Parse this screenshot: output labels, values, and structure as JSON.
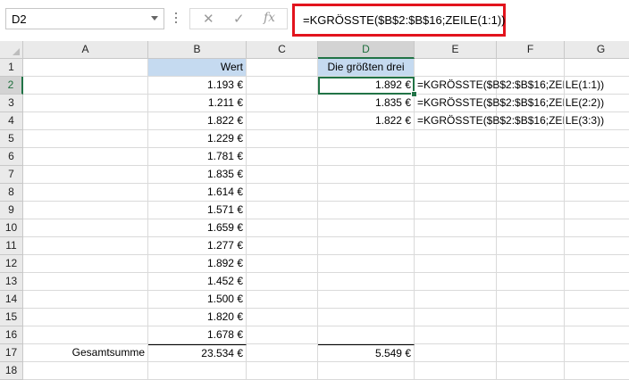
{
  "namebox": {
    "value": "D2"
  },
  "formula_bar": {
    "cancel_icon": "✕",
    "enter_icon": "✓",
    "fx_label": "fx",
    "formula": "=KGRÖSSTE($B$2:$B$16;ZEILE(1:1))"
  },
  "columns": [
    "A",
    "B",
    "C",
    "D",
    "E",
    "F",
    "G"
  ],
  "rows": [
    "1",
    "2",
    "3",
    "4",
    "5",
    "6",
    "7",
    "8",
    "9",
    "10",
    "11",
    "12",
    "13",
    "14",
    "15",
    "16",
    "17",
    "18"
  ],
  "cells": {
    "B1": "Wert",
    "D1": "Die größten drei",
    "B": [
      "1.193 €",
      "1.211 €",
      "1.822 €",
      "1.229 €",
      "1.781 €",
      "1.835 €",
      "1.614 €",
      "1.571 €",
      "1.659 €",
      "1.277 €",
      "1.892 €",
      "1.452 €",
      "1.500 €",
      "1.820 €",
      "1.678 €"
    ],
    "D": [
      "1.892 €",
      "1.835 €",
      "1.822 €"
    ],
    "E": [
      "=KGRÖSSTE($B$2:$B$16;ZEILE(1:1))",
      "=KGRÖSSTE($B$2:$B$16;ZEILE(2:2))",
      "=KGRÖSSTE($B$2:$B$16;ZEILE(3:3))"
    ],
    "A17": "Gesamtsumme",
    "B17": "23.534 €",
    "D17": "5.549 €"
  },
  "selection": {
    "cell": "D2",
    "accent_color": "#217346",
    "header_fill": "#c5daf0",
    "callout_color": "#e2141d"
  }
}
